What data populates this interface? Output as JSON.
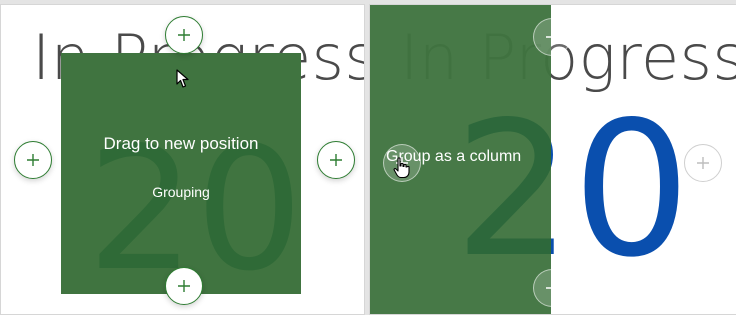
{
  "left_panel": {
    "title": "In Progress",
    "number": "20",
    "overlay_title": "Drag to new position",
    "overlay_subtitle": "Grouping"
  },
  "right_panel": {
    "title": "In Progress",
    "number": "20",
    "overlay_label": "Group as a column"
  },
  "colors": {
    "overlay_green": "#407440",
    "ghost_number_green": "#2f6a37",
    "number_blue": "#0a4fae",
    "title_gray": "#4a4a4a",
    "drop_target_border": "#2e7d32"
  },
  "icons": {
    "drop_target": "plus-icon",
    "cursor_move": "arrow-cursor-icon",
    "cursor_hand": "hand-pointer-icon"
  }
}
